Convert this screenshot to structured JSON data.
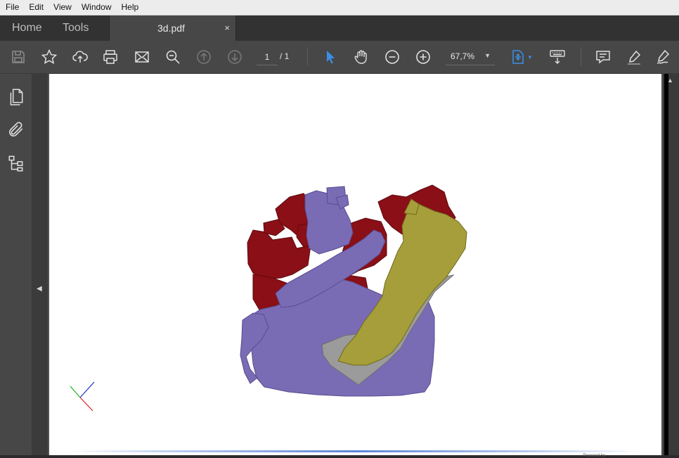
{
  "menu": [
    "File",
    "Edit",
    "View",
    "Window",
    "Help"
  ],
  "tabs": {
    "home": "Home",
    "tools": "Tools",
    "document": "3d.pdf",
    "close": "×"
  },
  "toolbar": {
    "icons": [
      "save-icon",
      "star-icon",
      "upload-cloud-icon",
      "print-icon",
      "email-icon",
      "zoom-search-icon",
      "page-up-icon",
      "page-down-icon",
      "select-arrow-icon",
      "hand-tool-icon",
      "zoom-out-icon",
      "zoom-in-icon",
      "fit-page-icon",
      "keyboard-scroll-icon",
      "comment-icon",
      "highlight-icon",
      "sign-icon"
    ],
    "page_current": "1",
    "page_total": "/ 1",
    "zoom": "67,7%",
    "zoom_caret": "▼"
  },
  "sidebar": {
    "icons": [
      "pages-icon",
      "attachment-icon",
      "structure-tree-icon"
    ],
    "collapse": "◀"
  },
  "document": {
    "model_colors": {
      "violet": "#7a6bb5",
      "red": "#8a0f16",
      "olive": "#a59e3a",
      "gray": "#9a9a9a"
    },
    "footer_text": "Powered by"
  },
  "scrollbar": {
    "up_arrow": "▲"
  },
  "colors": {
    "accent": "#3b8fe6",
    "toolbar_bg": "#474747",
    "tabbar_bg": "#323232"
  }
}
